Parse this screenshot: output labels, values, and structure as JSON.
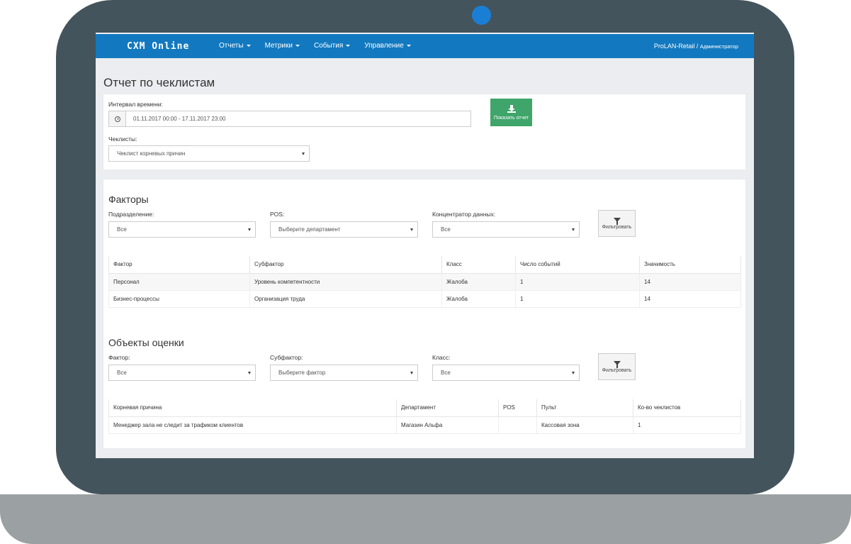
{
  "app": {
    "brand": "CXM Online",
    "nav": [
      "Отчеты",
      "Метрики",
      "События",
      "Управление"
    ],
    "user": {
      "org": "ProLAN-Retail",
      "separator": " / ",
      "role": "Администратор"
    }
  },
  "page": {
    "title": "Отчет по чеклистам",
    "interval_label": "Интервал времени:",
    "interval_value": "01.11.2017 00:00 - 17.11.2017 23:00",
    "checklists_label": "Чеклисты:",
    "checklists_value": "Чеклист корневых причин",
    "show_report_label": "Показать отчет"
  },
  "factors": {
    "title": "Факторы",
    "filters": [
      {
        "label": "Подразделение:",
        "value": "Все"
      },
      {
        "label": "POS:",
        "value": "Выберите департамент"
      },
      {
        "label": "Концентратор данных:",
        "value": "Все"
      }
    ],
    "filter_button": "Фильтровать",
    "columns": [
      "Фактор",
      "Субфактор",
      "Класс",
      "Число событий",
      "Значимость"
    ],
    "rows": [
      [
        "Персонал",
        "Уровень компетентности",
        "Жалоба",
        "1",
        "14"
      ],
      [
        "Бизнес-процессы",
        "Организация труда",
        "Жалоба",
        "1",
        "14"
      ]
    ]
  },
  "objects": {
    "title": "Объекты оценки",
    "filters": [
      {
        "label": "Фактор:",
        "value": "Все"
      },
      {
        "label": "Субфактор:",
        "value": "Выберите фактор"
      },
      {
        "label": "Класс:",
        "value": "Все"
      }
    ],
    "filter_button": "Фильтровать",
    "columns": [
      "Корневая причина",
      "Департамент",
      "POS",
      "Пульт",
      "Ко-во чеклистов"
    ],
    "rows": [
      [
        "Менеджер зала не следит за трафиком клиентов",
        "Магазин Альфа",
        "",
        "Кассовая зона",
        "1"
      ]
    ]
  },
  "colors": {
    "navbar": "#1279c0",
    "report_button": "#3fa56a",
    "laptop_frame": "#44545c",
    "camera": "#1a7fd4"
  }
}
